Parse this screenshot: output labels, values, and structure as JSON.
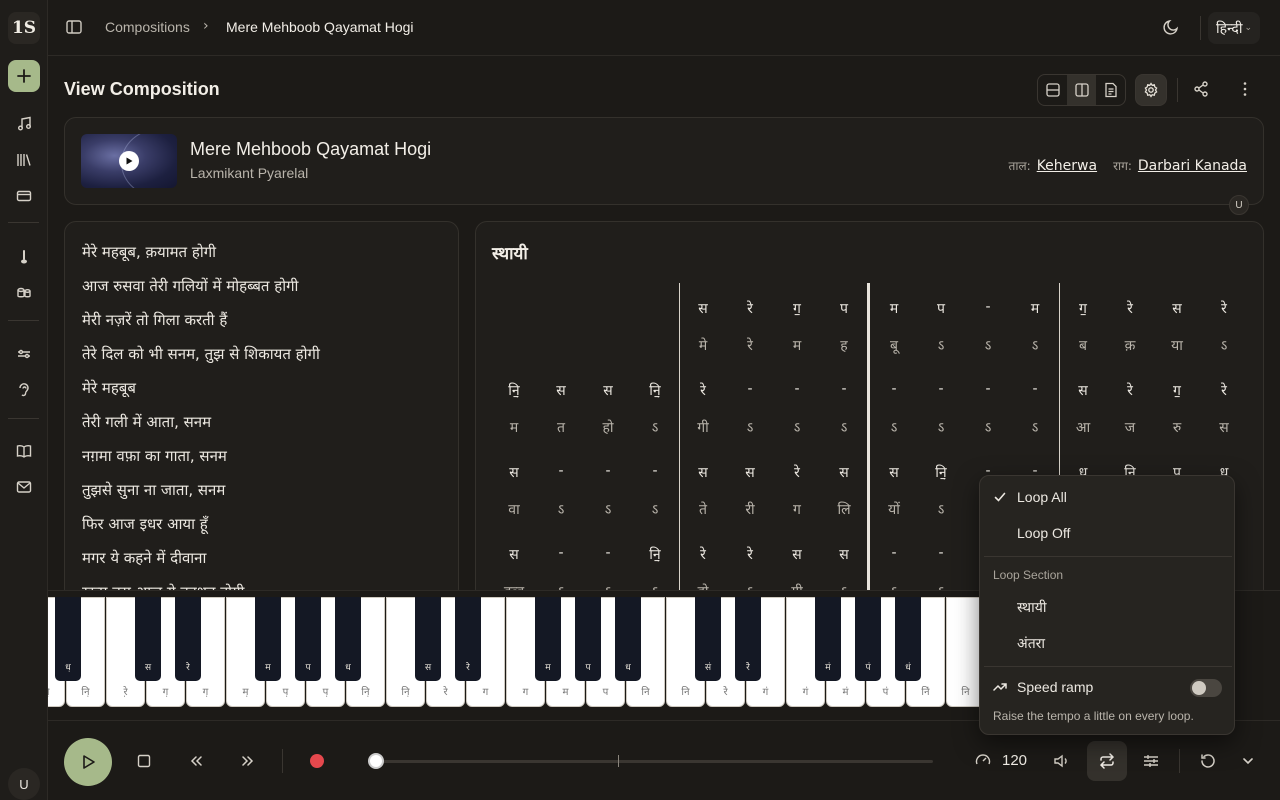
{
  "app": {
    "logo_text": "1S"
  },
  "user": {
    "initial": "U"
  },
  "breadcrumb": {
    "parent": "Compositions",
    "current": "Mere Mehboob Qayamat Hogi"
  },
  "language": {
    "label": "हिन्दी"
  },
  "page": {
    "title": "View Composition"
  },
  "song": {
    "title": "Mere Mehboob Qayamat Hogi",
    "artist": "Laxmikant Pyarelal",
    "taal_label": "ताल:",
    "taal_value": "Keherwa",
    "raag_label": "राग:",
    "raag_value": "Darbari Kanada"
  },
  "lyrics": [
    "मेरे महबूब, क़यामत होगी",
    "आज रुसवा तेरी गलियों में मोहब्बत होगी",
    "मेरी नज़रें तो गिला करती हैं",
    "तेरे दिल को भी सनम, तुझ से शिकायत होगी",
    "मेरे महबूब",
    "तेरी गली में आता, सनम",
    "नग़मा वफ़ा का गाता, सनम",
    "तुझसे सुना ना जाता, सनम",
    "फिर आज इधर आया हूँ",
    "मगर ये कहने में दीवाना",
    "ख़त्म बस आज ये वहशत होगी"
  ],
  "notation": {
    "section_title": "स्थायी",
    "rows": [
      {
        "swar": [
          "",
          "",
          "",
          "",
          "स",
          "रे",
          "ग॒",
          "प",
          "म",
          "प",
          "-",
          "म",
          "ग॒",
          "रे",
          "स",
          "रे"
        ],
        "lyric": [
          "",
          "",
          "",
          "",
          "मे",
          "रे",
          "म",
          "ह",
          "बू",
          "ऽ",
          "ऽ",
          "ऽ",
          "ब",
          "क़",
          "या",
          "ऽ"
        ]
      },
      {
        "swar": [
          "नि॒̣",
          "स",
          "स",
          "नि॒̣",
          "रे",
          "-",
          "-",
          "-",
          "-",
          "-",
          "-",
          "-",
          "स",
          "रे",
          "ग॒",
          "रे"
        ],
        "lyric": [
          "म",
          "त",
          "हो",
          "ऽ",
          "गी",
          "ऽ",
          "ऽ",
          "ऽ",
          "ऽ",
          "ऽ",
          "ऽ",
          "ऽ",
          "आ",
          "ज",
          "रु",
          "स"
        ]
      },
      {
        "swar": [
          "स",
          "-",
          "-",
          "-",
          "स",
          "स",
          "रे",
          "स",
          "स",
          "नि॒̣",
          "-",
          "-",
          "ध॒",
          "नि॒",
          "प",
          "ध॒"
        ],
        "lyric": [
          "वा",
          "ऽ",
          "ऽ",
          "ऽ",
          "ते",
          "री",
          "ग",
          "लि",
          "यों",
          "ऽ",
          "",
          "",
          "",
          "",
          "",
          ""
        ]
      },
      {
        "swar": [
          "स",
          "-",
          "-",
          "नि॒̣",
          "रे",
          "रे",
          "स",
          "स",
          "-",
          "-",
          "",
          "",
          "",
          "",
          "",
          ""
        ],
        "lyric": [
          "हब्ब",
          "ऽ",
          "ऽ",
          "ऽ",
          "हो",
          "ऽ",
          "गी",
          "ऽ",
          "ऽ",
          "ऽ",
          "",
          "",
          "",
          "",
          "",
          ""
        ]
      }
    ]
  },
  "keyboard": {
    "white_labels": [
      "नि̣",
      "नि̣",
      "रे̣",
      "ग̣",
      "ग̣",
      "म̣",
      "प̣",
      "प̣",
      "नि̣",
      "नि̣",
      "रे",
      "ग",
      "ग",
      "म",
      "प",
      "नि",
      "नि",
      "रे̇",
      "ग̇",
      "ग̇",
      "म̇",
      "प̇",
      "नि̇",
      "नि",
      "",
      "",
      "",
      "",
      "",
      "नि̇"
    ],
    "black_labels": [
      "ध̣",
      "स",
      "रे",
      "म",
      "प",
      "ध",
      "स",
      "रे",
      "म",
      "प",
      "ध",
      "स̇",
      "रे̇",
      "म̇",
      "प̇",
      "ध̇"
    ]
  },
  "player": {
    "tempo": "120"
  },
  "loop_menu": {
    "loop_all": "Loop All",
    "loop_off": "Loop Off",
    "section_label": "Loop Section",
    "section_1": "स्थायी",
    "section_2": "अंतरा",
    "speed_ramp": "Speed ramp",
    "speed_ramp_desc": "Raise the tempo a little on every loop.",
    "speed_ramp_enabled": false,
    "selected": "Loop All"
  },
  "colors": {
    "accent": "#a6b98a",
    "background": "#1c1a17",
    "record": "#e5484d"
  }
}
